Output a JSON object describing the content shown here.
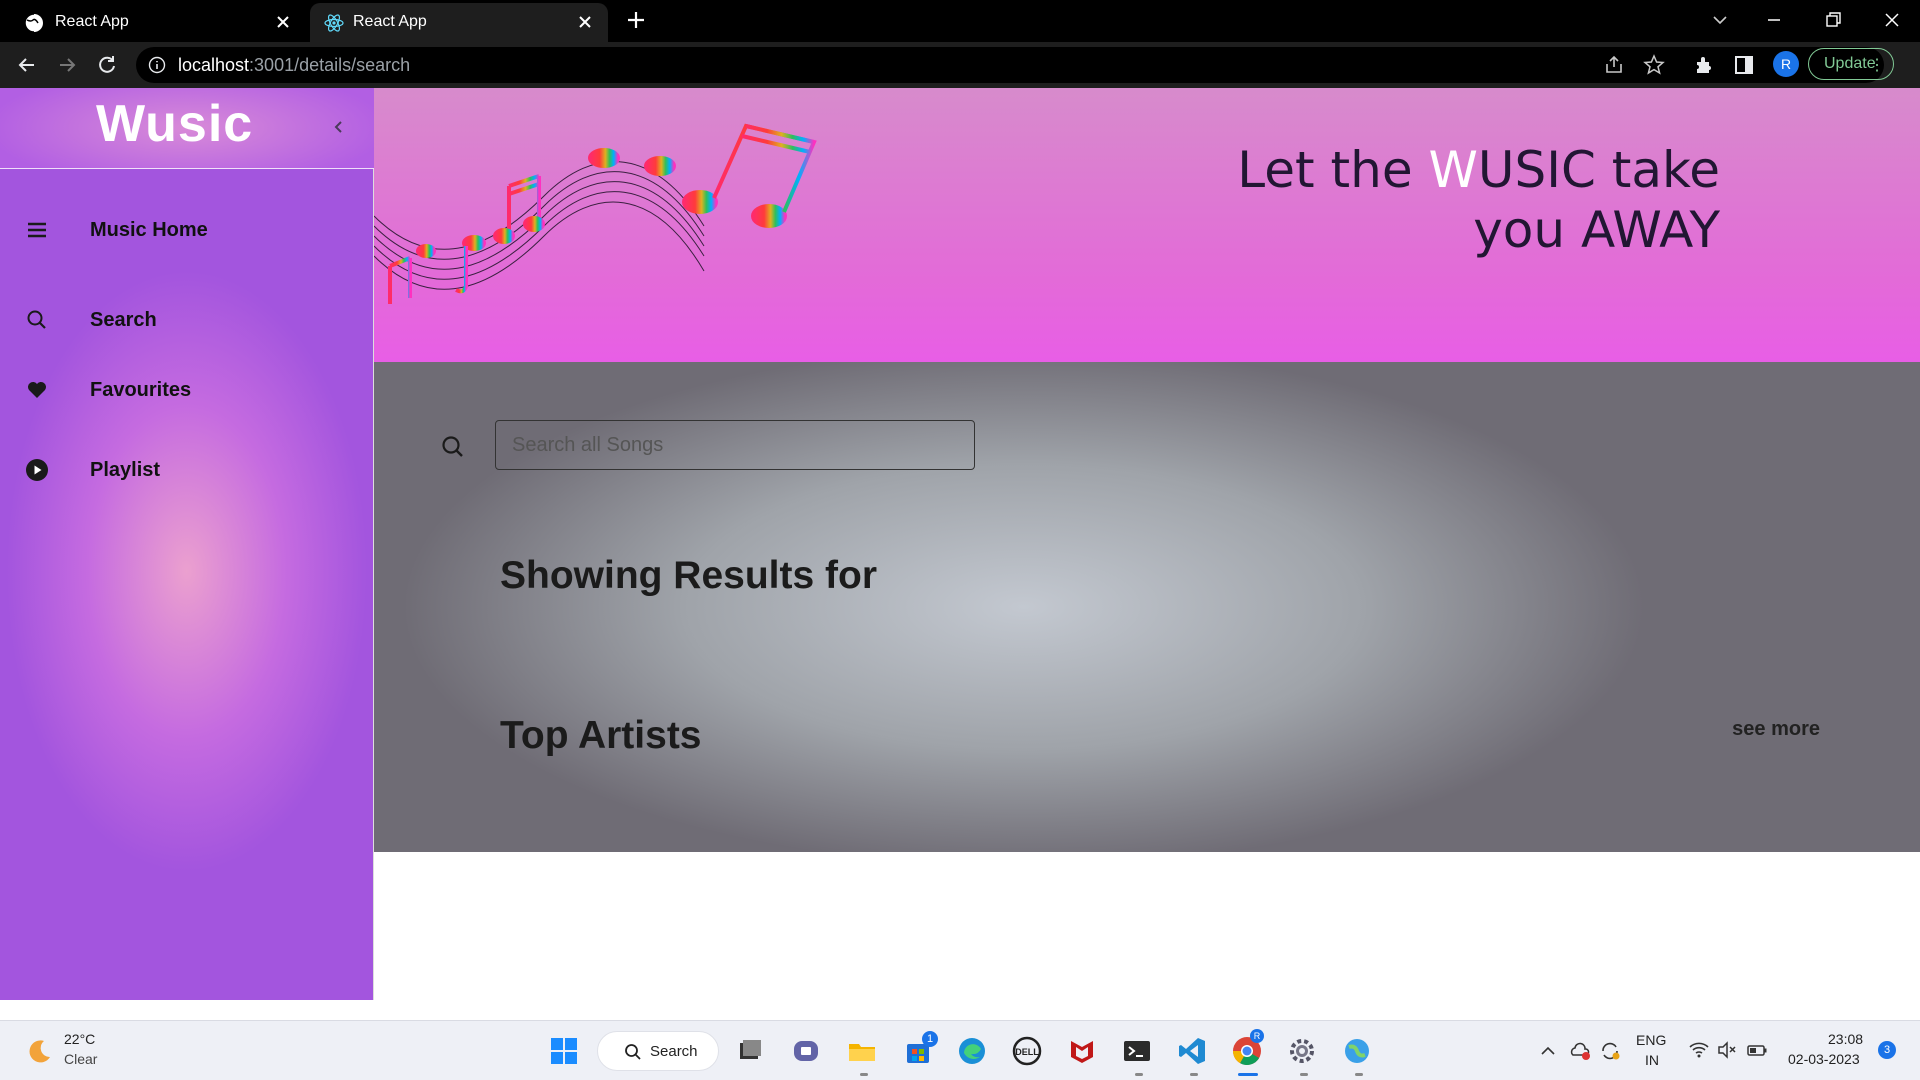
{
  "browser": {
    "tabs": [
      {
        "title": "React App",
        "active": false
      },
      {
        "title": "React App",
        "active": true
      }
    ],
    "url_host": "localhost",
    "url_path": ":3001/details/search",
    "profile_initial": "R",
    "update_label": "Update"
  },
  "app": {
    "logo": "Wusic",
    "nav": [
      {
        "label": "Music Home",
        "icon": "menu-icon"
      },
      {
        "label": "Search",
        "icon": "search-icon"
      },
      {
        "label": "Favourites",
        "icon": "heart-icon"
      },
      {
        "label": "Playlist",
        "icon": "play-circle-icon"
      }
    ],
    "tagline": {
      "pre": "Let the ",
      "highlight": "W",
      "post": "USIC take",
      "line2": "you AWAY"
    },
    "search": {
      "placeholder": "Search all Songs",
      "value": ""
    },
    "results_heading": "Showing Results for",
    "artists_heading": "Top Artists",
    "see_more": "see more"
  },
  "taskbar": {
    "weather_temp": "22°C",
    "weather_cond": "Clear",
    "search_label": "Search",
    "store_badge": "1",
    "lang_top": "ENG",
    "lang_bottom": "IN",
    "time": "23:08",
    "date": "02-03-2023",
    "notif_count": "3"
  },
  "colors": {
    "sidebar_accent": "#b25fe3",
    "hero_accent": "#e36ad8",
    "update_green": "#81c995"
  }
}
